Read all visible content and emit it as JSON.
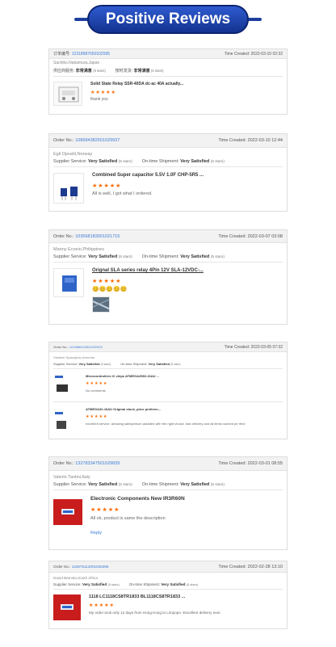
{
  "banner": {
    "title": "Positive Reviews"
  },
  "reviews": [
    {
      "order_label": "订单编号:",
      "order_no": "12318987650102595",
      "time_label": "Time Created:",
      "time": "2022-03-10 02:32",
      "buyer": "Sachiko.Nakamura,Japan",
      "supplier_service_label": "供应商服务:",
      "supplier_service": "非常满意",
      "supplier_stars": "(5 stars)",
      "shipment_label": "按时发货:",
      "shipment": "非常满意",
      "shipment_stars": "(5 stars)",
      "products": [
        {
          "title": "Solid State Relay SSR-40DA dc-ac 40A actually...",
          "stars": "★★★★★",
          "comment": "thank you"
        }
      ]
    },
    {
      "order_label": "Order No.:",
      "order_no": "108994382501029937",
      "time_label": "Time Created:",
      "time": "2022-03-10 12:44",
      "buyer": "Egil Opsahl,Norway",
      "supplier_service_label": "Supplier Service:",
      "supplier_service": "Very Satisfied",
      "supplier_stars": "(5 stars)",
      "shipment_label": "On-time Shipment:",
      "shipment": "Very Satisfied",
      "shipment_stars": "(5 stars)",
      "products": [
        {
          "title": "Combined Super capacitor 5.5V 1.0F CHP-5R5 ...",
          "stars": "★★★★★",
          "comment": "All is well, I got what I ordered."
        }
      ]
    },
    {
      "order_label": "Order No.:",
      "order_no": "103568183001021715",
      "time_label": "Time Created:",
      "time": "2022-03-07 03:08",
      "buyer": "Manny Ecoeio,Philippines",
      "supplier_service_label": "Supplier Service:",
      "supplier_service": "Very Satisfied",
      "supplier_stars": "(5 stars)",
      "shipment_label": "On-time Shipment:",
      "shipment": "Very Satisfied",
      "shipment_stars": "(5 stars)",
      "products": [
        {
          "title": "Orignal SLA series relay 4Pin 12V SLA-12VDC-...",
          "stars": "★★★★★",
          "comment": "😊😊😊😊😊"
        }
      ]
    },
    {
      "order_label": "Order No.:",
      "order_no": "1015860126010223G9",
      "time_label": "Time Created:",
      "time": "2022-03-05 07:32",
      "buyer": "Vladimir Spasojevic,Armenia",
      "supplier_service_label": "Supplier Service:",
      "supplier_service": "Very Satisfied",
      "supplier_stars": "(5 stars)",
      "shipment_label": "On-time Shipment:",
      "shipment": "Very Satisfied",
      "shipment_stars": "(5 stars)",
      "products": [
        {
          "title": "Microcontrollers IC chips ATMEGA2560-16AU ...",
          "stars": "★★★★★",
          "comment": "No comments"
        },
        {
          "title": "ATMEGA32-16AU Original stock, price preferen...",
          "stars": "★★★★★",
          "comment": "excellent service. amazing salesperson assisted with the right choice. fast delivery and all items worked pe rfect"
        }
      ]
    },
    {
      "order_label": "Order No.:",
      "order_no": "132783347501029839",
      "time_label": "Time Created:",
      "time": "2022-03-01 08:55",
      "buyer": "Valerio Tantini,Italy",
      "supplier_service_label": "Supplier Service:",
      "supplier_service": "Very Satisfied",
      "supplier_stars": "(5 stars)",
      "shipment_label": "On-time Shipment:",
      "shipment": "Very Satisfied",
      "shipment_stars": "(5 stars)",
      "products": [
        {
          "title": "Electronic Components New IR3R60N",
          "stars": "★★★★★",
          "comment": "All ok, product is same the description",
          "reply": "Reply"
        }
      ]
    },
    {
      "order_label": "Order No.:",
      "order_no": "134675114001025395",
      "time_label": "Time Created:",
      "time": "2022-02-28 13:10",
      "buyer": "David Barnola,South Africa",
      "supplier_service_label": "Supplier Service:",
      "supplier_service": "Very Satisfied",
      "supplier_stars": "(5 stars)",
      "shipment_label": "On-time Shipment:",
      "shipment": "Very Satisfied",
      "shipment_stars": "(5 stars)",
      "products": [
        {
          "title": "1118 LC1118CS8TR1833 BL1118CS8TR1833 ...",
          "stars": "★★★★★",
          "comment": "My order  took only 12 days from Hong Kong to Limpopo -Excellent delivery ever."
        }
      ]
    }
  ]
}
